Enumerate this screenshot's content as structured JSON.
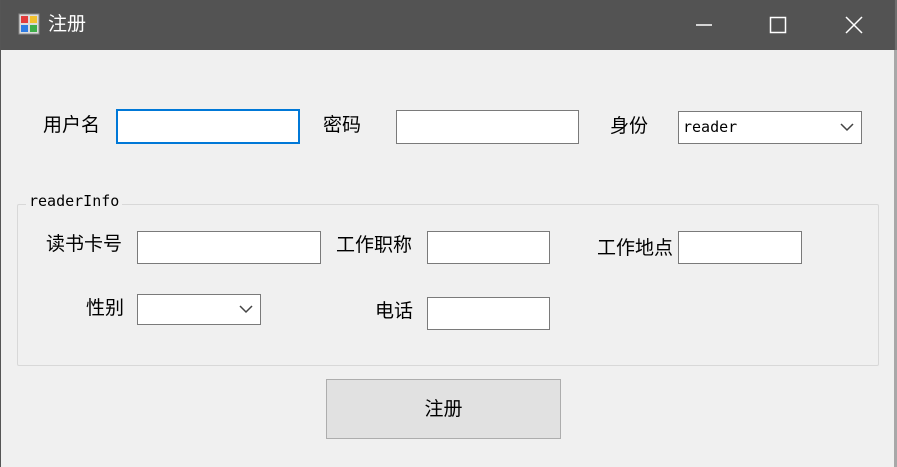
{
  "window": {
    "title": "注册",
    "icon": "app-form-icon",
    "controls": [
      "minimize-icon",
      "maximize-icon",
      "close-icon"
    ]
  },
  "form": {
    "username_label": "用户名",
    "username_value": "",
    "password_label": "密码",
    "password_value": "",
    "identity_label": "身份",
    "identity_value": "reader"
  },
  "reader_info": {
    "legend": "readerInfo",
    "card_no_label": "读书卡号",
    "card_no_value": "",
    "job_title_label": "工作职称",
    "job_title_value": "",
    "work_place_label": "工作地点",
    "work_place_value": "",
    "gender_label": "性别",
    "gender_value": "",
    "phone_label": "电话",
    "phone_value": ""
  },
  "actions": {
    "register_label": "注册"
  },
  "colors": {
    "titlebar": "#535353",
    "window_bg": "#f0f0f0",
    "focus_border": "#0078d7",
    "button_bg": "#e1e1e1"
  }
}
